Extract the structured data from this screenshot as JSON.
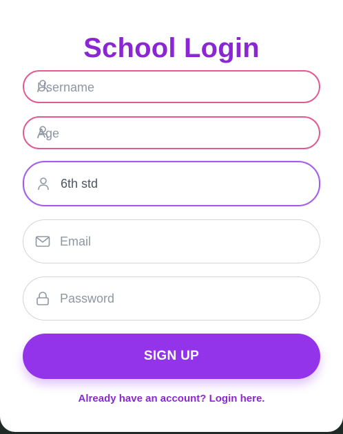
{
  "form": {
    "title": "School Login",
    "username_placeholder": "Username",
    "age_placeholder": "Age",
    "class_value": "6th std",
    "email_placeholder": "Email",
    "password_placeholder": "Password",
    "signup_label": "SIGN UP",
    "login_link": "Already have an account? Login here."
  },
  "icons": {
    "username": "user-icon",
    "age": "user-icon",
    "class": "user-icon",
    "email": "mail-icon",
    "password": "lock-icon"
  },
  "colors": {
    "brand": "#8a27d2",
    "button": "#9333ea",
    "error_border": "#e05a94",
    "focus_border": "#a15ce8"
  }
}
